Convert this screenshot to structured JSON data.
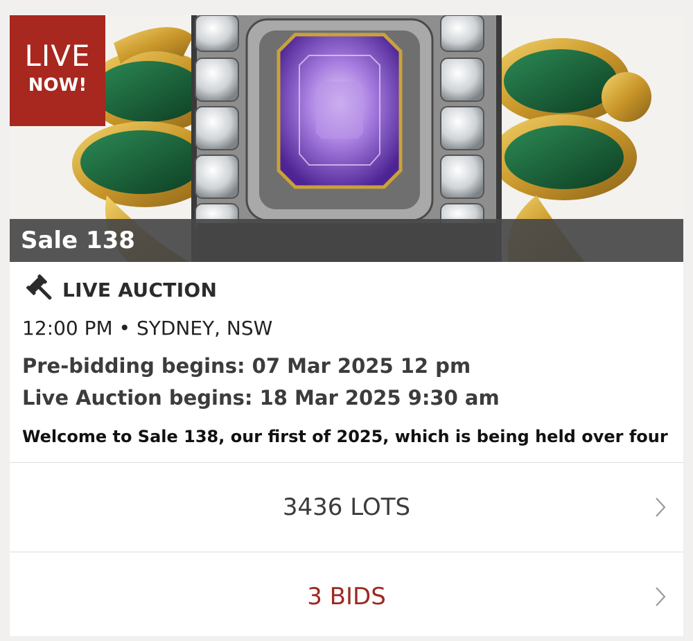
{
  "badge": {
    "line1": "LIVE",
    "line2": "NOW!"
  },
  "sale": {
    "title": "Sale 138"
  },
  "auction": {
    "type_label": "LIVE AUCTION",
    "time_location": "12:00 PM • SYDNEY, NSW",
    "prebidding": "Pre-bidding begins: 07 Mar 2025 12 pm",
    "live_begins": "Live Auction begins: 18 Mar 2025 9:30 am",
    "description": "Welcome to Sale 138, our first of 2025, which is being held over four"
  },
  "links": {
    "lots": "3436 LOTS",
    "bids": "3 BIDS"
  },
  "icons": {
    "gavel": "gavel-icon",
    "chevron": "chevron-right-icon"
  },
  "colors": {
    "badge_red": "#a8271f",
    "bids_red": "#9b2a22",
    "enamel_green": "#1f6b3c",
    "gold": "#c9a23a",
    "amethyst": "#8a5ac8"
  }
}
